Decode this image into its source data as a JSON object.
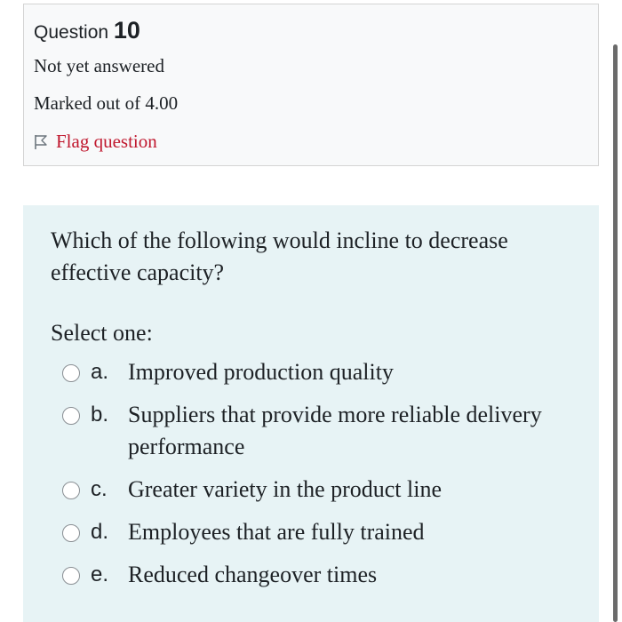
{
  "question_info": {
    "label": "Question",
    "number": "10",
    "state": "Not yet answered",
    "grade": "Marked out of 4.00",
    "flag_label": "Flag question",
    "flag_icon": "flag-outline-icon",
    "flag_color": "#c0182e"
  },
  "question": {
    "text": "Which of the following would incline to decrease effective capacity?",
    "prompt": "Select one:",
    "answers": [
      {
        "letter": "a.",
        "text": "Improved production quality"
      },
      {
        "letter": "b.",
        "text": "Suppliers that provide more reliable delivery performance"
      },
      {
        "letter": "c.",
        "text": "Greater variety in the product line"
      },
      {
        "letter": "d.",
        "text": "Employees that are fully trained"
      },
      {
        "letter": "e.",
        "text": "Reduced changeover times"
      }
    ]
  },
  "colors": {
    "info_bg": "#f8f9fa",
    "formulation_bg": "#e7f3f5"
  }
}
